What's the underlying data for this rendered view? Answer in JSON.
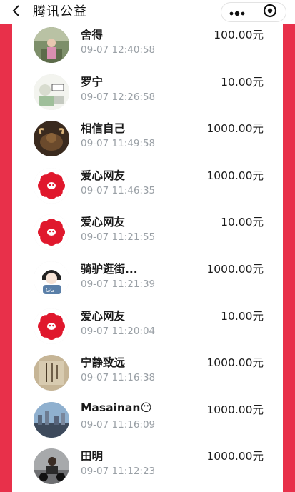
{
  "app": {
    "title": "腾讯公益"
  },
  "colors": {
    "accent": "#e8304a",
    "time_text": "#9aa0a6",
    "primary_text": "#1a1a1a"
  },
  "nav": {
    "back_icon": "chevron-left-icon",
    "more_icon": "more-dots-icon",
    "close_icon": "target-circle-icon"
  },
  "donations": [
    {
      "name": "舍得",
      "time": "09-07 12:40:58",
      "amount": "100.00元",
      "avatar": "photo-person"
    },
    {
      "name": "罗宁",
      "time": "09-07 12:26:58",
      "amount": "10.00元",
      "avatar": "photo-cartoon"
    },
    {
      "name": "相信自己",
      "time": "09-07 11:49:58",
      "amount": "1000.00元",
      "avatar": "photo-bull"
    },
    {
      "name": "爱心网友",
      "time": "09-07 11:46:35",
      "amount": "1000.00元",
      "avatar": "red-flower"
    },
    {
      "name": "爱心网友",
      "time": "09-07 11:21:55",
      "amount": "10.00元",
      "avatar": "red-flower"
    },
    {
      "name": "骑驴逛街...",
      "time": "09-07 11:21:39",
      "amount": "1000.00元",
      "avatar": "drawing-girl"
    },
    {
      "name": "爱心网友",
      "time": "09-07 11:20:04",
      "amount": "10.00元",
      "avatar": "red-flower"
    },
    {
      "name": "宁静致远",
      "time": "09-07 11:16:38",
      "amount": "1000.00元",
      "avatar": "calligraphy"
    },
    {
      "name": "Masainan😶",
      "time": "09-07 11:16:09",
      "amount": "1000.00元",
      "avatar": "photo-city"
    },
    {
      "name": "田明",
      "time": "09-07 11:12:23",
      "amount": "1000.00元",
      "avatar": "photo-motorbike"
    }
  ]
}
